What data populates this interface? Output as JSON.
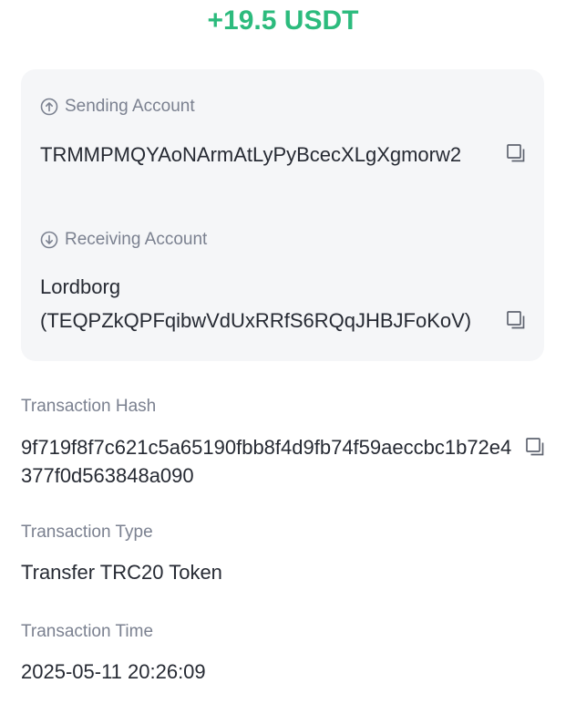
{
  "amount": "+19.5 USDT",
  "colors": {
    "amount_green": "#2cbb7d",
    "label_gray": "#7b8190",
    "card_bg": "#f5f6f8",
    "text_dark": "#262a33"
  },
  "sending": {
    "label": "Sending Account",
    "icon": "arrow-up-circle-icon",
    "address": "TRMMPMQYAoNArmAtLyPyBcecXLgXgmorw2"
  },
  "receiving": {
    "label": "Receiving Account",
    "icon": "arrow-down-circle-icon",
    "name_line": "Lordborg",
    "address_line": "(TEQPZkQPFqibwVdUxRRfS6RQqJHBJFoKoV)"
  },
  "hash": {
    "label": "Transaction Hash",
    "value": "9f719f8f7c621c5a65190fbb8f4d9fb74f59aeccbc1b72e4377f0d563848a090"
  },
  "type": {
    "label": "Transaction Type",
    "value": "Transfer TRC20 Token"
  },
  "time": {
    "label": "Transaction Time",
    "value": "2025-05-11 20:26:09"
  },
  "copy_icon": "copy-icon"
}
